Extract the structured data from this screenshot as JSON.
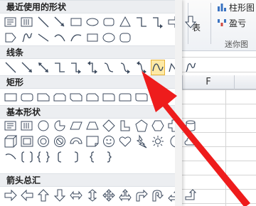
{
  "ribbon": {
    "chart_column_label": "柱形图",
    "chart_winloss_label": "盈亏",
    "table_partial_label": "表",
    "sparklines_group_label": "迷你图"
  },
  "sheet": {
    "column_f": "F"
  },
  "shapes_panel": {
    "sections": [
      {
        "title": "最近使用的形状",
        "key": "recent"
      },
      {
        "title": "线条",
        "key": "lines"
      },
      {
        "title": "矩形",
        "key": "rectangles"
      },
      {
        "title": "基本形状",
        "key": "basic"
      },
      {
        "title": "箭头总汇",
        "key": "arrows"
      }
    ],
    "selected_shape": "freeform-curve"
  },
  "colors": {
    "highlight_fill": "#fde9a6",
    "highlight_border": "#e8b33a",
    "annotation_arrow": "#ee1c1c",
    "section_header_bg": "#eceef1"
  }
}
